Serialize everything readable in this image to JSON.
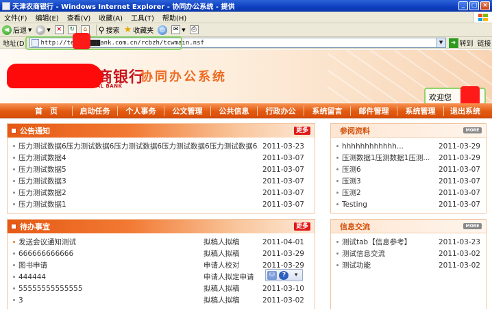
{
  "window": {
    "title": "天津农商银行 - Windows Internet Explorer - 协同办公系统 - 提供",
    "min": "_",
    "max": "□",
    "close": "×"
  },
  "menu": [
    "文件(F)",
    "编辑(E)",
    "查看(V)",
    "收藏(A)",
    "工具(T)",
    "帮助(H)"
  ],
  "toolbar": {
    "back": "后退",
    "search": "搜索",
    "favorites": "收藏夹"
  },
  "address": {
    "label": "地址(D)",
    "url": "http://testo████ank.com.cn/rcbzh/tcwmain.nsf",
    "go": "转到",
    "links": "链接"
  },
  "banner": {
    "bank_name": "商银行",
    "bank_en": "RCIAL BANK",
    "system_title": "协同办公系统",
    "welcome": "欢迎您"
  },
  "nav": [
    "首　页",
    "启动任务",
    "个人事务",
    "公文管理",
    "公共信息",
    "行政办公",
    "系统留言",
    "邮件管理",
    "系统管理",
    "退出系统"
  ],
  "notices": {
    "title": "公告通知",
    "more": "更多",
    "items": [
      {
        "title": "压力测试数据6压力测试数据6压力测试数据6压力测试数据6压力测试数据6...",
        "date": "2011-03-23"
      },
      {
        "title": "压力测试数据4",
        "date": "2011-03-07"
      },
      {
        "title": "压力测试数据5",
        "date": "2011-03-07"
      },
      {
        "title": "压力测试数据3",
        "date": "2011-03-07"
      },
      {
        "title": "压力测试数据2",
        "date": "2011-03-07"
      },
      {
        "title": "压力测试数据1",
        "date": "2011-03-07"
      }
    ]
  },
  "todo": {
    "title": "待办事宜",
    "more": "更多",
    "items": [
      {
        "title": "发送会议通知测试",
        "status": "拟稿人拟稿",
        "date": "2011-04-01"
      },
      {
        "title": "666666666666",
        "status": "拟稿人拟稿",
        "date": "2011-03-29"
      },
      {
        "title": "图书申请",
        "status": "申请人校对",
        "date": "2011-03-29"
      },
      {
        "title": "444444",
        "status": "申请人拟定申请",
        "date": ""
      },
      {
        "title": "55555555555555",
        "status": "拟稿人拟稿",
        "date": "2011-03-10"
      },
      {
        "title": "3",
        "status": "拟稿人拟稿",
        "date": "2011-03-02"
      }
    ]
  },
  "references": {
    "title": "参阅资料",
    "more": "MORE",
    "items": [
      {
        "title": "hhhhhhhhhhhh...",
        "date": "2011-03-29"
      },
      {
        "title": "压测数据1压测数据1压测...",
        "date": "2011-03-29"
      },
      {
        "title": "压测6",
        "date": "2011-03-07"
      },
      {
        "title": "压测3",
        "date": "2011-03-07"
      },
      {
        "title": "压测2",
        "date": "2011-03-07"
      },
      {
        "title": "Testing",
        "date": "2011-03-07"
      }
    ]
  },
  "exchange": {
    "title": "信息交流",
    "more": "MORE",
    "items": [
      {
        "title": "测试tab【信息参考】",
        "date": "2011-03-23"
      },
      {
        "title": "测试信息交流",
        "date": "2011-03-02"
      },
      {
        "title": "测试功能",
        "date": "2011-03-02"
      }
    ]
  }
}
